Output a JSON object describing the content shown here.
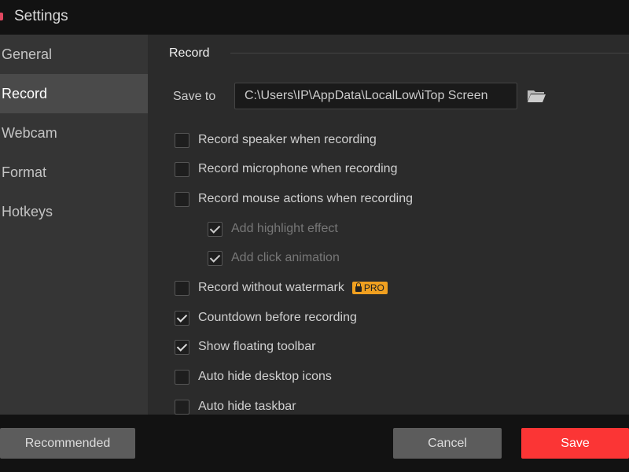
{
  "window": {
    "title": "Settings"
  },
  "sidebar": {
    "items": [
      {
        "label": "General"
      },
      {
        "label": "Record",
        "active": true
      },
      {
        "label": "Webcam"
      },
      {
        "label": "Format"
      },
      {
        "label": "Hotkeys"
      }
    ]
  },
  "main": {
    "section_title": "Record",
    "save_to_label": "Save to",
    "save_to_path": "C:\\Users\\IP\\AppData\\LocalLow\\iTop Screen",
    "options": [
      {
        "label": "Record speaker when recording",
        "checked": false
      },
      {
        "label": "Record microphone when recording",
        "checked": false
      },
      {
        "label": "Record mouse actions when recording",
        "checked": false
      },
      {
        "label": "Add highlight effect",
        "checked": true,
        "sub": true
      },
      {
        "label": "Add click animation",
        "checked": true,
        "sub": true
      },
      {
        "label": "Record without watermark",
        "checked": false,
        "badge": "PRO"
      },
      {
        "label": "Countdown before recording",
        "checked": true
      },
      {
        "label": "Show floating toolbar",
        "checked": true
      },
      {
        "label": "Auto hide desktop icons",
        "checked": false
      },
      {
        "label": "Auto hide taskbar",
        "checked": false
      }
    ]
  },
  "footer": {
    "recommended": "Recommended",
    "cancel": "Cancel",
    "save": "Save"
  },
  "colors": {
    "save": "#fb3535",
    "pro_badge": "#f0a020"
  }
}
